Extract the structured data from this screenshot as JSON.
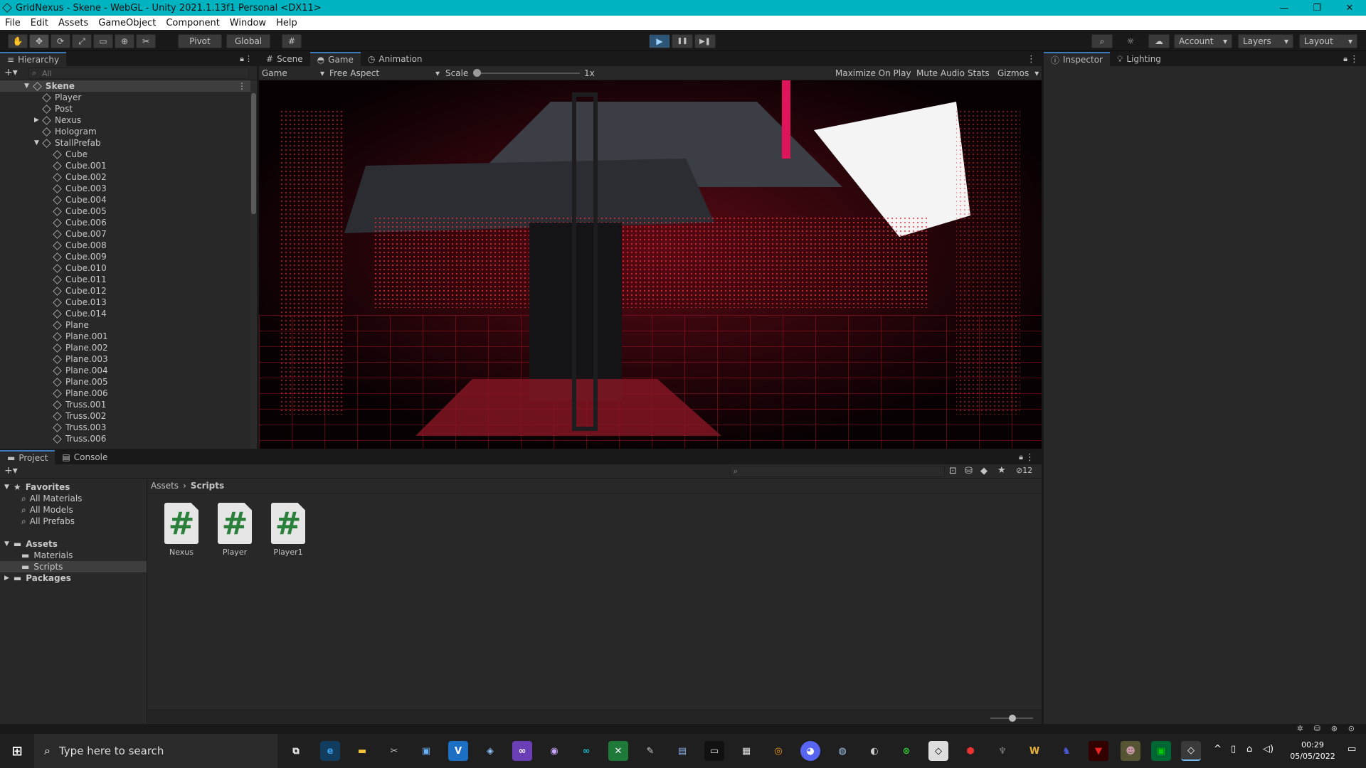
{
  "window": {
    "title": "GridNexus - Skene - WebGL - Unity 2021.1.13f1 Personal <DX11>",
    "controls": {
      "minimize": "—",
      "restore": "❐",
      "close": "✕"
    }
  },
  "menu": [
    "File",
    "Edit",
    "Assets",
    "GameObject",
    "Component",
    "Window",
    "Help"
  ],
  "toolbar": {
    "pivot": "Pivot",
    "global": "Global",
    "account": "Account",
    "layers": "Layers",
    "layout": "Layout",
    "play": "▶",
    "pause": "❚❚",
    "step": "▶❚"
  },
  "hierarchy": {
    "tab": "Hierarchy",
    "search_placeholder": "All",
    "scene": "Skene",
    "items": [
      "Player",
      "Post",
      "Nexus",
      "Hologram",
      "StallPrefab",
      "Cube",
      "Cube.001",
      "Cube.002",
      "Cube.003",
      "Cube.004",
      "Cube.005",
      "Cube.006",
      "Cube.007",
      "Cube.008",
      "Cube.009",
      "Cube.010",
      "Cube.011",
      "Cube.012",
      "Cube.013",
      "Cube.014",
      "Plane",
      "Plane.001",
      "Plane.002",
      "Plane.003",
      "Plane.004",
      "Plane.005",
      "Plane.006",
      "Truss.001",
      "Truss.002",
      "Truss.003",
      "Truss.006"
    ]
  },
  "game_view": {
    "tabs": [
      "Scene",
      "Game",
      "Animation"
    ],
    "display": "Game",
    "aspect": "Free Aspect",
    "scale_label": "Scale",
    "scale_value": "1x",
    "scale_fraction": 0.0,
    "options": [
      "Maximize On Play",
      "Mute Audio",
      "Stats",
      "Gizmos"
    ]
  },
  "inspector": {
    "tabs": [
      "Inspector",
      "Lighting"
    ]
  },
  "project": {
    "tabs": [
      "Project",
      "Console"
    ],
    "hidden_count": "12",
    "favorites": {
      "label": "Favorites",
      "items": [
        "All Materials",
        "All Models",
        "All Prefabs"
      ]
    },
    "assets": {
      "label": "Assets",
      "items": [
        "Materials",
        "Scripts"
      ]
    },
    "packages": "Packages",
    "breadcrumb": [
      "Assets",
      "Scripts"
    ],
    "files": [
      "Nexus",
      "Player",
      "Player1"
    ]
  },
  "taskbar": {
    "search_placeholder": "Type here to search",
    "time": "00:29",
    "date": "05/05/2022"
  },
  "colors": {
    "accent": "#00b3c0",
    "selection": "#2c5d87",
    "tab_highlight": "#3a79bb",
    "script_hash": "#2a7f3a"
  }
}
